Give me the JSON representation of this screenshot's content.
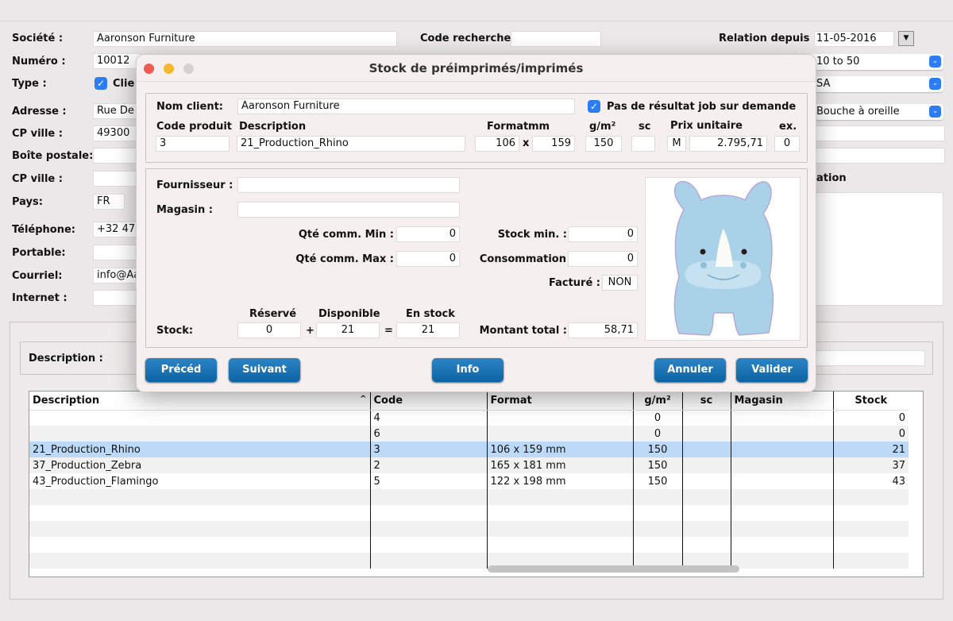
{
  "background_form": {
    "societe_label": "Société :",
    "societe": "Aaronson Furniture",
    "code_recherche_label": "Code recherche:",
    "code_recherche": "",
    "relation_label": "Relation depuis :",
    "relation_date": "11-05-2016",
    "numero_label": "Numéro :",
    "numero": "10012",
    "type_label": "Type :",
    "type_checkbox": "Clie",
    "adresse_label": "Adresse :",
    "adresse": "Rue De",
    "cp_ville_label": "CP ville :",
    "cp": "49300",
    "boite_label": "Boîte postale:",
    "cp_ville2_label": "CP ville :",
    "pays_label": "Pays:",
    "pays": "FR",
    "tel_label": "Téléphone:",
    "tel": "+32 47",
    "portable_label": "Portable:",
    "courriel_label": "Courriel:",
    "courriel": "info@Aa",
    "internet_label": "Internet :",
    "combo1": "10 to 50",
    "combo2": "SA",
    "combo3": "Bouche à oreille",
    "partial_label": "ation",
    "description_label": "Description :"
  },
  "table": {
    "columns": [
      "Description",
      "Code",
      "Format",
      "g/m²",
      "sc",
      "Magasin",
      "Stock"
    ],
    "sort_indicator": "^",
    "rows": [
      {
        "description": "",
        "code": "4",
        "format": "",
        "gsm": "0",
        "sc": "",
        "magasin": "",
        "stock": "0"
      },
      {
        "description": "",
        "code": "6",
        "format": "",
        "gsm": "0",
        "sc": "",
        "magasin": "",
        "stock": "0"
      },
      {
        "description": "21_Production_Rhino",
        "code": "3",
        "format": "106 x 159 mm",
        "gsm": "150",
        "sc": "",
        "magasin": "",
        "stock": "21",
        "selected": true
      },
      {
        "description": "37_Production_Zebra",
        "code": "2",
        "format": "165 x 181 mm",
        "gsm": "150",
        "sc": "",
        "magasin": "",
        "stock": "37"
      },
      {
        "description": "43_Production_Flamingo",
        "code": "5",
        "format": "122 x 198 mm",
        "gsm": "150",
        "sc": "",
        "magasin": "",
        "stock": "43"
      }
    ]
  },
  "dialog": {
    "title": "Stock de préimprimés/imprimés",
    "nom_client_label": "Nom client:",
    "nom_client": "Aaronson Furniture",
    "checkbox_label": "Pas de résultat job sur demande",
    "checkbox_checked": true,
    "code_produit_label": "Code produit",
    "code_produit": "3",
    "description_label": "Description",
    "description": "21_Production_Rhino",
    "format_label": "Format",
    "format_unit": "mm",
    "format_w": "106",
    "format_x": "x",
    "format_h": "159",
    "gsm_label": "g/m²",
    "gsm": "150",
    "sc_label": "sc",
    "sc": "",
    "prix_label": "Prix unitaire",
    "prix_unit": "M",
    "prix": "2.795,71",
    "ex_label": "ex.",
    "ex": "0",
    "fournisseur_label": "Fournisseur :",
    "fournisseur": "",
    "magasin_label": "Magasin :",
    "magasin": "",
    "qte_min_label": "Qté comm. Min :",
    "qte_min": "0",
    "qte_max_label": "Qté comm. Max :",
    "qte_max": "0",
    "stock_min_label": "Stock min. :",
    "stock_min": "0",
    "consommation_label": "Consommation",
    "consommation": "0",
    "facture_label": "Facturé :",
    "facture": "NON",
    "reserve_label": "Réservé",
    "reserve": "0",
    "disponible_label": "Disponible",
    "disponible": "21",
    "en_stock_label": "En stock",
    "en_stock": "21",
    "stock_label": "Stock:",
    "plus": "+",
    "equals": "=",
    "montant_label": "Montant total :",
    "montant": "58,71",
    "buttons": {
      "prev": "Précéd",
      "next": "Suivant",
      "info": "Info",
      "cancel": "Annuler",
      "ok": "Valider"
    }
  },
  "colors": {
    "accent": "#2b7cf6",
    "button": "#1670b0",
    "selected_row": "#bcdaf7",
    "rhino": "#a9d1e8"
  }
}
